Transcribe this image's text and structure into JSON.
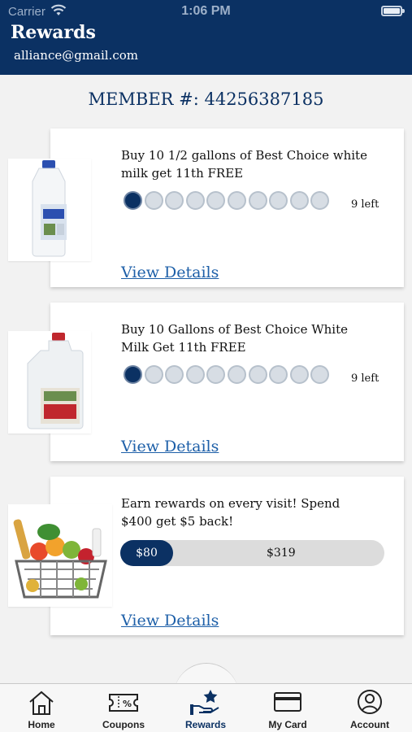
{
  "status_bar": {
    "carrier": "Carrier",
    "time": "1:06 PM"
  },
  "header": {
    "title": "Rewards",
    "email": "alliance@gmail.com"
  },
  "member": {
    "label": "MEMBER #: 44256387185"
  },
  "rewards": [
    {
      "title": "Buy 10 1/2 gallons of Best Choice white milk get 11th FREE",
      "image_icon": "half-gallon-milk-jug",
      "stamps_total": 10,
      "stamps_filled": 1,
      "left_text": "9 left",
      "link": "View Details"
    },
    {
      "title": "Buy 10 Gallons of Best Choice White Milk Get 11th FREE",
      "image_icon": "gallon-milk-jug",
      "stamps_total": 10,
      "stamps_filled": 1,
      "left_text": "9 left",
      "link": "View Details"
    },
    {
      "title": "Earn rewards on every visit! Spend $400 get $5 back!",
      "image_icon": "grocery-basket",
      "spent_label": "$80",
      "remaining_label": "$319",
      "progress": 0.2,
      "link": "View Details"
    }
  ],
  "tabbar": {
    "active": "Rewards",
    "items": [
      {
        "label": "Home",
        "icon": "home-icon"
      },
      {
        "label": "Coupons",
        "icon": "coupon-icon"
      },
      {
        "label": "Rewards",
        "icon": "rewards-icon"
      },
      {
        "label": "My Card",
        "icon": "card-icon"
      },
      {
        "label": "Account",
        "icon": "account-icon"
      }
    ]
  },
  "colors": {
    "primary": "#0b3163",
    "link": "#1d5fa8",
    "background": "#f2f2f2"
  }
}
